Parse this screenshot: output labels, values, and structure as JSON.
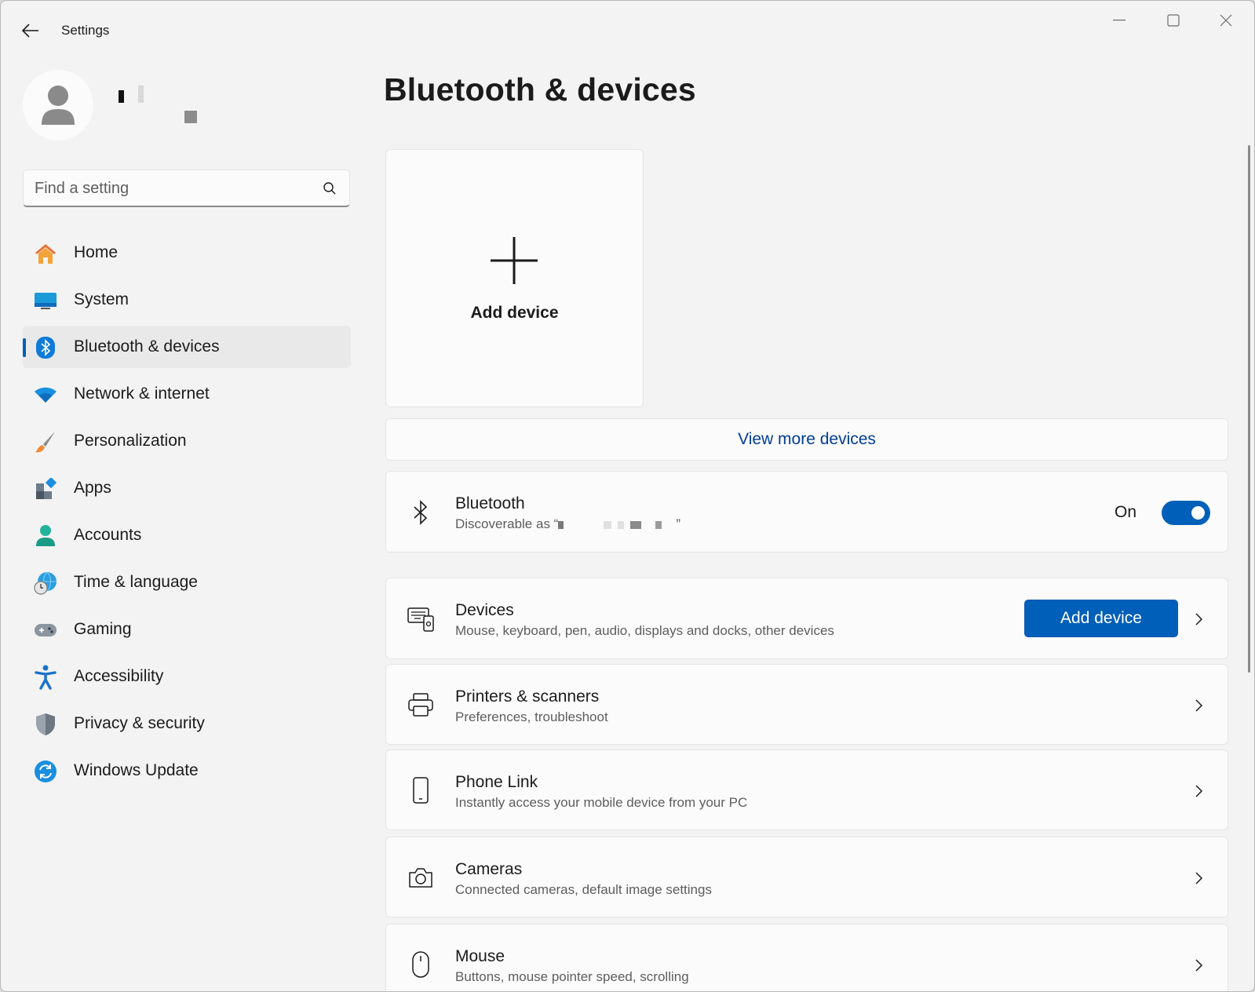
{
  "window": {
    "title": "Settings"
  },
  "search": {
    "placeholder": "Find a setting"
  },
  "nav": {
    "items": [
      {
        "label": "Home",
        "icon": "home-icon",
        "selected": false
      },
      {
        "label": "System",
        "icon": "system-icon",
        "selected": false
      },
      {
        "label": "Bluetooth & devices",
        "icon": "bluetooth-icon",
        "selected": true
      },
      {
        "label": "Network & internet",
        "icon": "wifi-icon",
        "selected": false
      },
      {
        "label": "Personalization",
        "icon": "brush-icon",
        "selected": false
      },
      {
        "label": "Apps",
        "icon": "apps-icon",
        "selected": false
      },
      {
        "label": "Accounts",
        "icon": "accounts-icon",
        "selected": false
      },
      {
        "label": "Time & language",
        "icon": "globe-clock-icon",
        "selected": false
      },
      {
        "label": "Gaming",
        "icon": "gamepad-icon",
        "selected": false
      },
      {
        "label": "Accessibility",
        "icon": "accessibility-icon",
        "selected": false
      },
      {
        "label": "Privacy & security",
        "icon": "shield-icon",
        "selected": false
      },
      {
        "label": "Windows Update",
        "icon": "update-icon",
        "selected": false
      }
    ]
  },
  "main": {
    "title": "Bluetooth & devices",
    "add_tile": {
      "label": "Add device"
    },
    "view_more": "View more devices",
    "bluetooth": {
      "title": "Bluetooth",
      "subtitle_prefix": "Discoverable as “",
      "subtitle_suffix": "”",
      "state": "On"
    },
    "rows": [
      {
        "title": "Devices",
        "subtitle": "Mouse, keyboard, pen, audio, displays and docks, other devices",
        "icon": "devices-icon",
        "button": "Add device"
      },
      {
        "title": "Printers & scanners",
        "subtitle": "Preferences, troubleshoot",
        "icon": "printer-icon"
      },
      {
        "title": "Phone Link",
        "subtitle": "Instantly access your mobile device from your PC",
        "icon": "phone-icon"
      },
      {
        "title": "Cameras",
        "subtitle": "Connected cameras, default image settings",
        "icon": "camera-icon"
      },
      {
        "title": "Mouse",
        "subtitle": "Buttons, mouse pointer speed, scrolling",
        "icon": "mouse-icon"
      }
    ]
  },
  "colors": {
    "accent": "#005fb8",
    "link": "#003e92",
    "background": "#f3f3f3",
    "card": "#fbfbfb"
  }
}
